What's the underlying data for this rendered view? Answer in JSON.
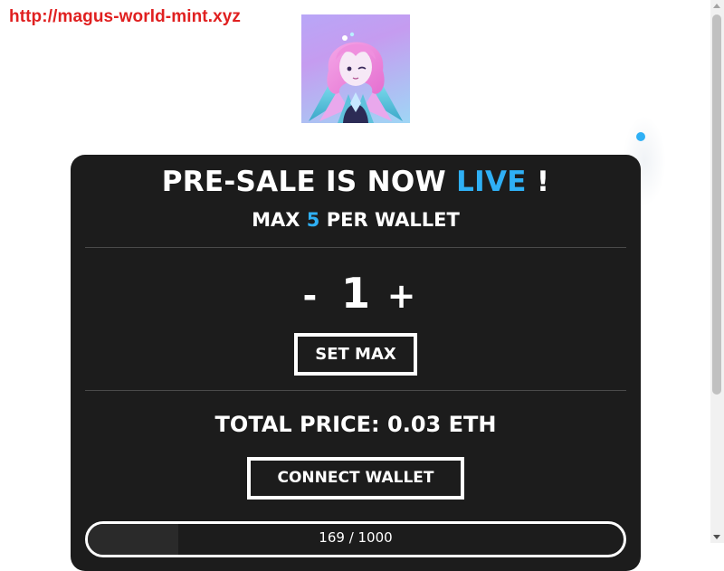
{
  "url_banner": "http://magus-world-mint.xyz",
  "logo": {
    "icon": "anime-character-logo"
  },
  "mint": {
    "headline_prefix": "PRE-SALE IS NOW ",
    "headline_accent": "LIVE",
    "headline_suffix": " !",
    "limit_prefix": "MAX ",
    "limit_value": "5",
    "limit_suffix": " PER WALLET",
    "decrement_label": "-",
    "quantity": "1",
    "increment_label": "+",
    "set_max_label": "SET MAX",
    "total_price_label": "TOTAL PRICE: 0.03 ETH",
    "connect_label": "CONNECT WALLET",
    "supply_text": "169 / 1000",
    "supply_minted": 169,
    "supply_total": 1000
  },
  "colors": {
    "accent": "#2fb0f5",
    "card_background": "#1c1c1c",
    "url_red": "#e02020"
  }
}
